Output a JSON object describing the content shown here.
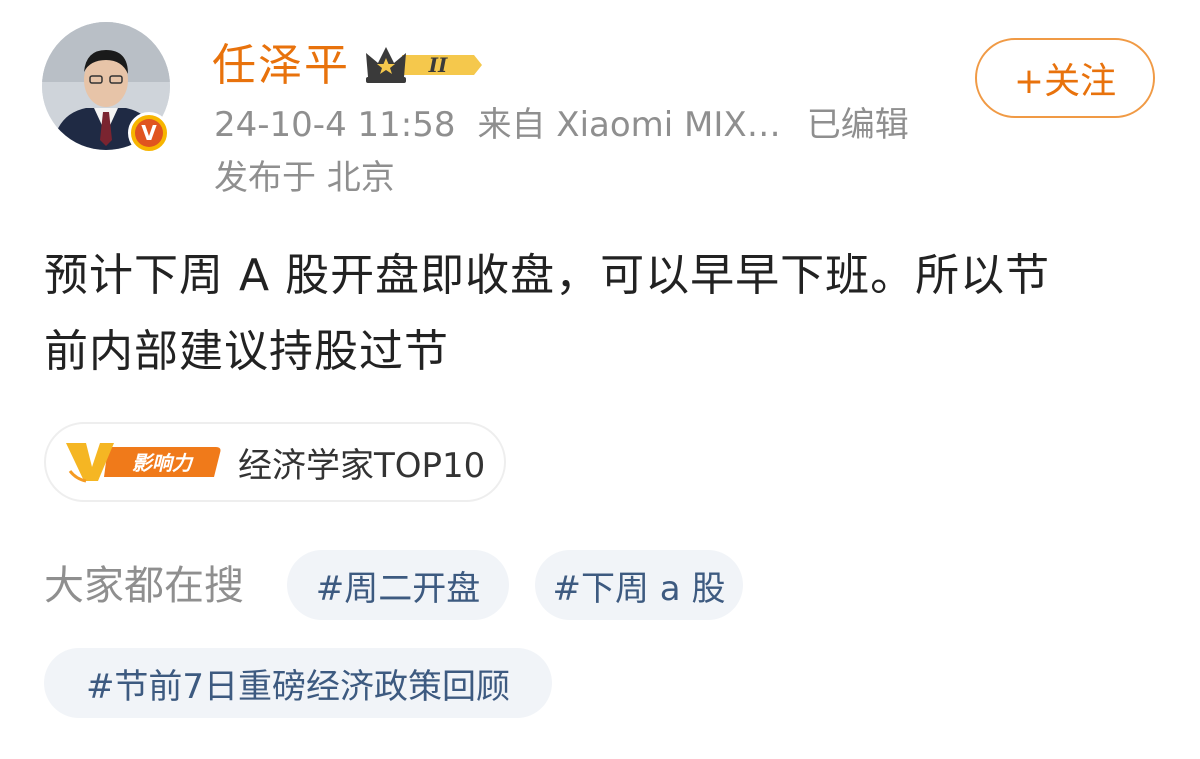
{
  "author": {
    "name": "任泽平",
    "level_badge": "II",
    "verified_mark": "V"
  },
  "follow_button": {
    "label": "+关注"
  },
  "post": {
    "timestamp": "24-10-4 11:58",
    "source": "来自 Xiaomi MIX…",
    "edited": "已编辑",
    "location": "发布于 北京",
    "text_line1": "预计下周 A 股开盘即收盘，可以早早下班。所以节",
    "text_line2": "前内部建议持股过节"
  },
  "influence": {
    "badge_letter": "V",
    "badge_text": "影响力",
    "label": "经济学家TOP10"
  },
  "trending": {
    "label": "大家都在搜",
    "tags": [
      "#周二开盘",
      "#下周 a 股",
      "#节前7日重磅经济政策回顾"
    ]
  },
  "colors": {
    "accent": "#e8720c",
    "muted": "#8f8f8f",
    "chip_bg": "#f1f4f8",
    "chip_text": "#3d5a80"
  }
}
